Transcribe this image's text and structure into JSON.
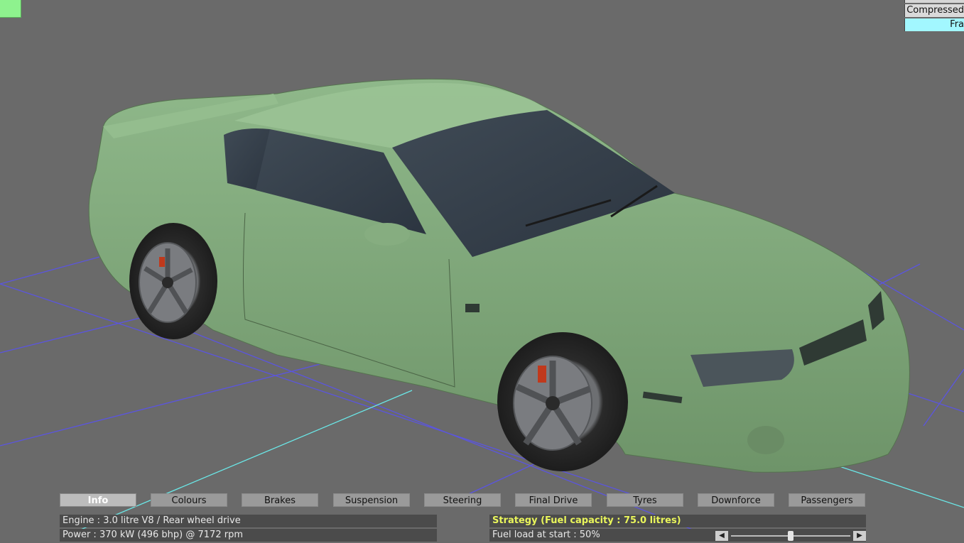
{
  "colors": {
    "background": "#6a6a6a",
    "car_body": "#7fa67a",
    "grid_line": "#5b55e0",
    "axis_line": "#6ae8e8",
    "strategy_text": "#e9f55b"
  },
  "top_right": {
    "compressed_label": "Compressed",
    "front_label": "Fra"
  },
  "tabs": [
    {
      "label": "Info",
      "active": true
    },
    {
      "label": "Colours",
      "active": false
    },
    {
      "label": "Brakes",
      "active": false
    },
    {
      "label": "Suspension",
      "active": false
    },
    {
      "label": "Steering",
      "active": false
    },
    {
      "label": "Final Drive",
      "active": false
    },
    {
      "label": "Tyres",
      "active": false
    },
    {
      "label": "Downforce",
      "active": false
    },
    {
      "label": "Passengers",
      "active": false
    }
  ],
  "info": {
    "engine": "Engine : 3.0 litre V8 / Rear wheel drive",
    "power": "Power : 370 kW (496 bhp) @ 7172 rpm"
  },
  "strategy": {
    "title": "Strategy (Fuel capacity : 75.0 litres)",
    "fuel_load": "Fuel load at start : 50%",
    "fuel_fraction": 0.5
  },
  "icons": {
    "slider_left": "arrow-left-icon",
    "slider_right": "arrow-right-icon"
  }
}
